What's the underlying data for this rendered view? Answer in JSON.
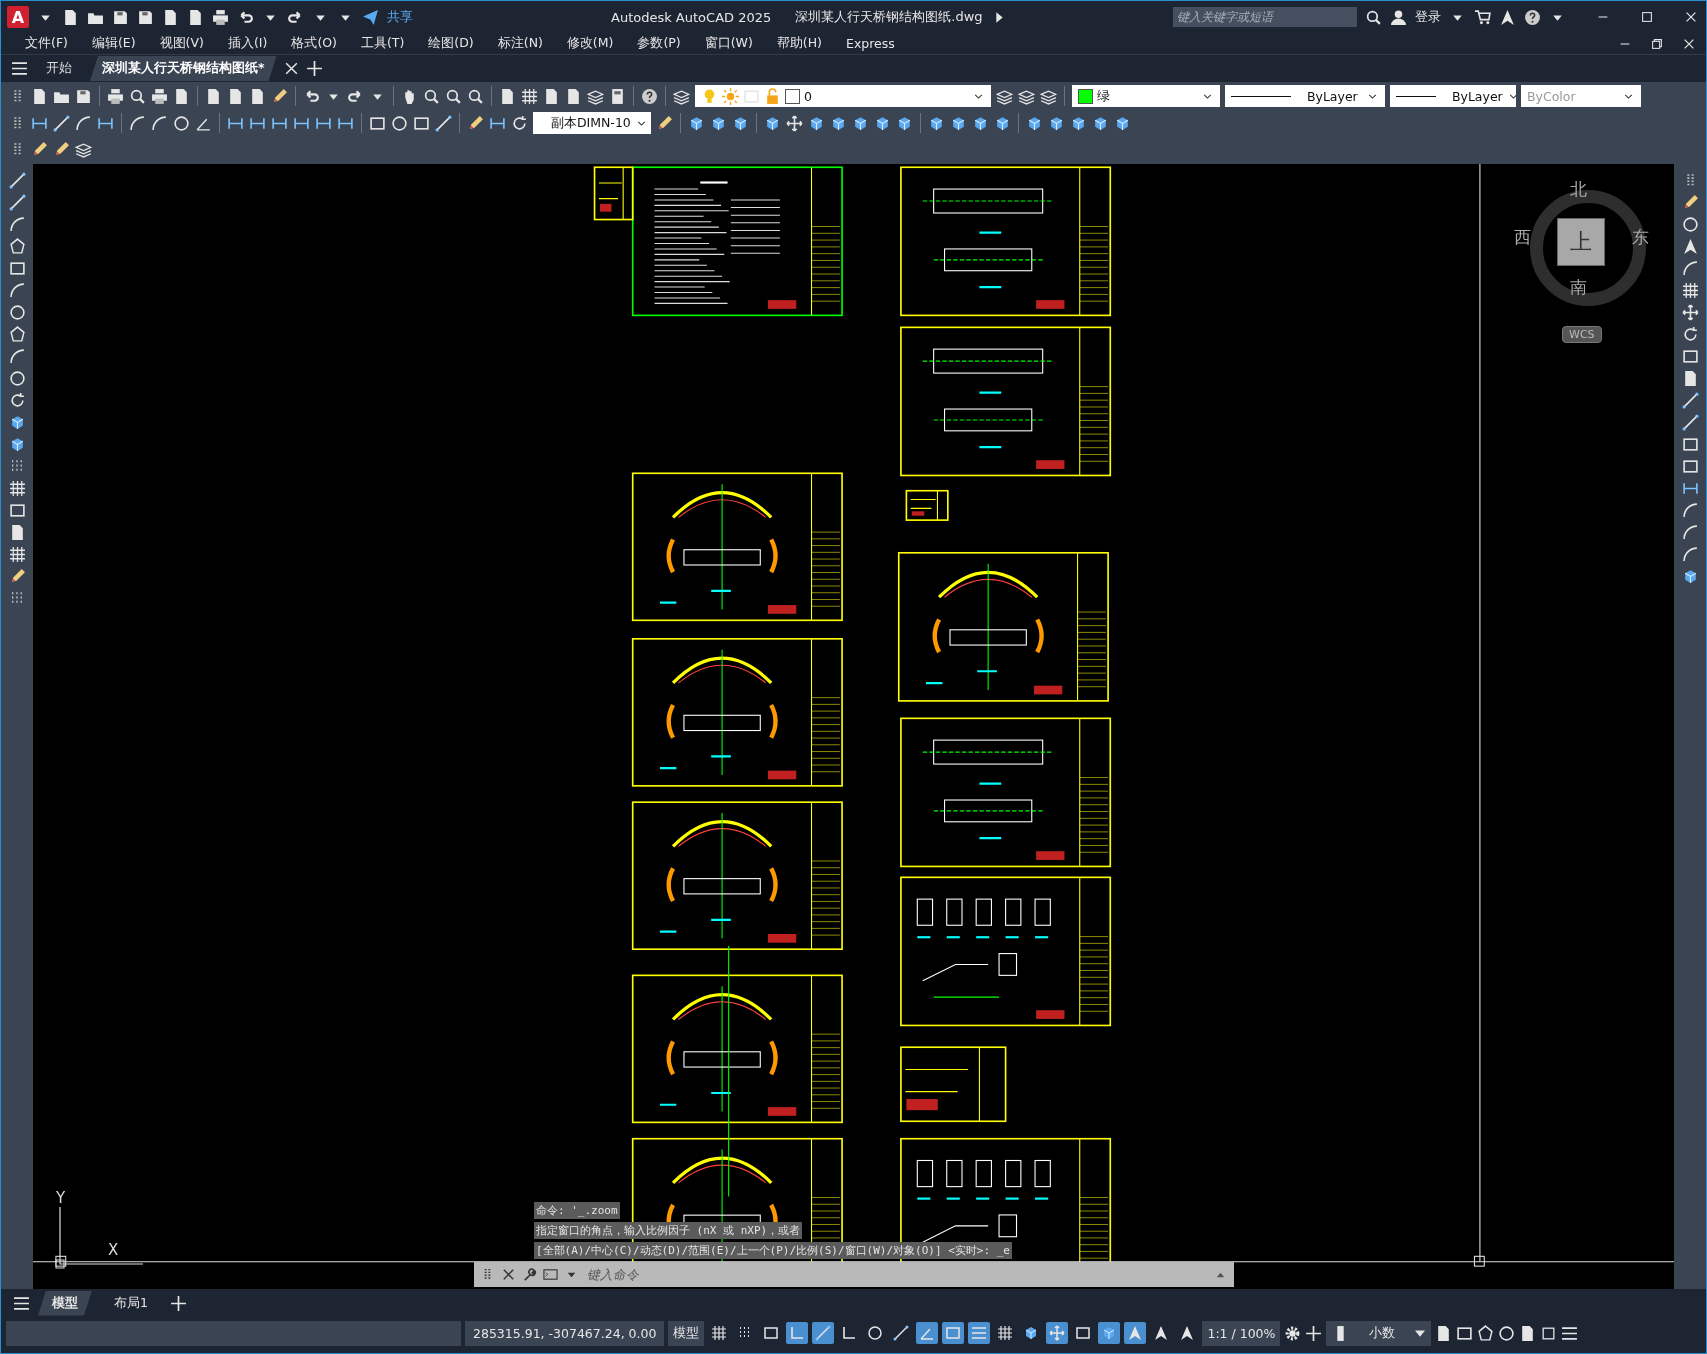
{
  "title_bar": {
    "logo": "A",
    "share": "共享",
    "app_title": "Autodesk AutoCAD 2025",
    "file_name": "深圳某人行天桥钢结构图纸.dwg",
    "search": {
      "placeholder": "键入关键字或短语"
    },
    "sign_in": "登录"
  },
  "menu_bar": [
    "文件(F)",
    "编辑(E)",
    "视图(V)",
    "插入(I)",
    "格式(O)",
    "工具(T)",
    "绘图(D)",
    "标注(N)",
    "修改(M)",
    "参数(P)",
    "窗口(W)",
    "帮助(H)",
    "Express"
  ],
  "doc_tabs": [
    {
      "label": "开始",
      "selected": false
    },
    {
      "label": "深圳某人行天桥钢结构图纸*",
      "selected": true
    }
  ],
  "toolbars": {
    "layer": "0",
    "dim_style": "副本DIMN-10",
    "color_name": "绿",
    "linetype": "ByLayer",
    "lineweight": "ByLayer",
    "plot_style": {
      "value": "ByColor",
      "disabled": true
    }
  },
  "viewcube": {
    "north": "北",
    "west": "西",
    "east": "东",
    "south": "南",
    "top": "上",
    "wcs": "WCS"
  },
  "ucs": {
    "y": "Y",
    "x": "X"
  },
  "command_history": [
    "命令: '_.zoom",
    "指定窗口的角点，输入比例因子 (nX 或 nXP)，或者",
    "[全部(A)/中心(C)/动态(D)/范围(E)/上一个(P)/比例(S)/窗口(W)/对象(O)] <实时>: _e"
  ],
  "command_line": {
    "placeholder": "键入命令"
  },
  "layout_tabs": [
    {
      "label": "模型",
      "selected": true
    },
    {
      "label": "布局1",
      "selected": false
    }
  ],
  "status_bar": {
    "coordinates": "285315.91, -307467.24, 0.00",
    "space": "模型",
    "scale": "1:1 / 100%",
    "units": "小数",
    "toggles": [
      {
        "on": false
      },
      {
        "on": false
      },
      {
        "on": false
      },
      {
        "on": true
      },
      {
        "on": true
      },
      {
        "on": false
      },
      {
        "on": false
      },
      {
        "on": false
      },
      {
        "on": true
      },
      {
        "on": true
      },
      {
        "on": true
      },
      {
        "on": false
      },
      {
        "on": false
      },
      {
        "on": true
      },
      {
        "on": false
      },
      {
        "on": true
      },
      {
        "on": true
      },
      {
        "on": false
      },
      {
        "on": false
      }
    ]
  }
}
